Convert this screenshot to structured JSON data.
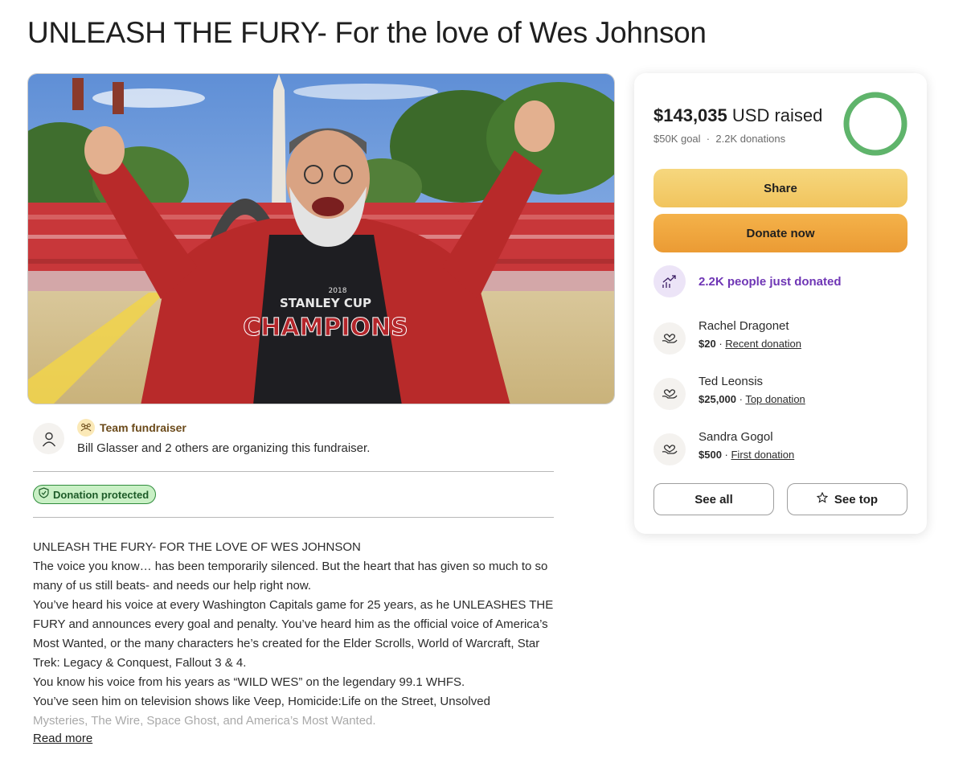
{
  "campaign": {
    "title": "UNLEASH THE FURY- For the love of Wes Johnson"
  },
  "organizer": {
    "team_label": "Team fundraiser",
    "text": "Bill Glasser and 2 others are organizing this fundraiser."
  },
  "protection": {
    "label": "Donation protected"
  },
  "story": {
    "paragraphs": [
      "UNLEASH THE FURY- FOR THE LOVE OF WES JOHNSON",
      "The voice you know… has been temporarily silenced. But the heart that has given so much to so many of us still beats- and needs our help right now.",
      "You’ve heard his voice at every Washington Capitals game for 25 years, as he UNLEASHES THE FURY and announces every goal and penalty. You’ve heard him as the official voice of America’s Most Wanted, or the many characters he’s created for the Elder Scrolls, World of Warcraft, Star Trek: Legacy & Conquest, Fallout 3 & 4.",
      "You know his voice from his years as “WILD WES” on the legendary 99.1 WHFS.",
      "You’ve seen him on television shows like Veep, Homicide:Life on the Street, Unsolved",
      "Mysteries, The Wire, Space Ghost, and America’s Most Wanted."
    ],
    "read_more": "Read more"
  },
  "progress": {
    "raised_amount": "$143,035",
    "raised_suffix": " USD raised",
    "goal": "$50K goal",
    "separator": "·",
    "donations": "2.2K donations",
    "ring_fraction": 1.0
  },
  "actions": {
    "share": "Share",
    "donate": "Donate now",
    "see_all": "See all",
    "see_top": "See top"
  },
  "activity": {
    "text": "2.2K people just donated"
  },
  "donors": [
    {
      "name": "Rachel Dragonet",
      "amount": "$20",
      "label": "Recent donation"
    },
    {
      "name": "Ted Leonsis",
      "amount": "$25,000",
      "label": "Top donation"
    },
    {
      "name": "Sandra Gogol",
      "amount": "$500",
      "label": "First donation"
    }
  ],
  "hero_image": {
    "shirt_line1": "STANLEY CUP",
    "shirt_line2": "CHAMPIONS",
    "shirt_year": "2018"
  },
  "colors": {
    "ring": "#5fb46b",
    "activity_purple": "#6f36b5",
    "protected_green": "#2f8c3c",
    "share_yellow": "#f3cd6a",
    "donate_orange": "#eea23b"
  },
  "icons": {
    "organizer": "person-icon",
    "team": "team-icon",
    "protected": "shield-check-icon",
    "activity": "trending-up-icon",
    "donor": "heart-hand-icon",
    "see_top": "star-icon"
  }
}
